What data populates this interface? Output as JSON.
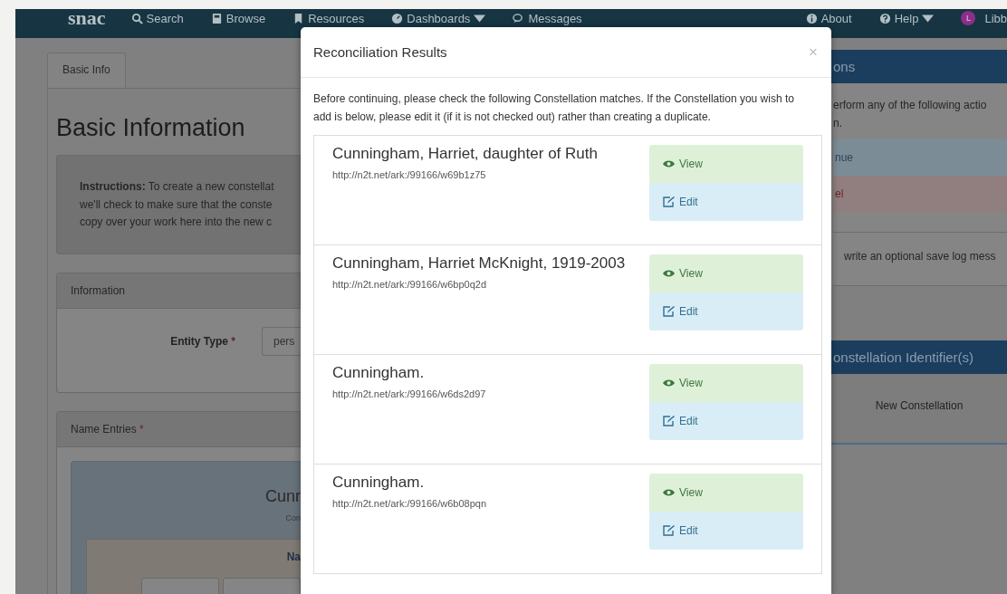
{
  "navbar": {
    "brand": "snac",
    "items": [
      {
        "label": "Search",
        "has_menu": false
      },
      {
        "label": "Browse",
        "has_menu": false
      },
      {
        "label": "Resources",
        "has_menu": false
      },
      {
        "label": "Dashboards",
        "has_menu": true
      },
      {
        "label": "Messages",
        "has_menu": false
      }
    ],
    "right_items": [
      {
        "label": "About",
        "has_menu": false
      },
      {
        "label": "Help",
        "has_menu": true
      }
    ],
    "avatar": "L",
    "user": "Libb"
  },
  "editor": {
    "tab": "Basic Info",
    "heading": "Basic Information",
    "instructions": [
      "**Instructions:** To create a new constellat",
      "we'll check to make sure that the conste",
      "copy over your work here into the new c"
    ],
    "information": {
      "title": "Information",
      "field_label": "Entity Type",
      "required_mark": "*",
      "field_value": "pers"
    },
    "name_entries": {
      "title": "Name Entries",
      "required_mark": "*",
      "heading": "Cunr",
      "subheading": "Con",
      "inner_heading": "Na"
    }
  },
  "modal": {
    "title": "Reconciliation Results",
    "close": "×",
    "intro": "Before continuing, please check the following Constellation matches. If the Constellation you wish to add is below, please edit it (if it is not checked out) rather than creating a duplicate.",
    "results": [
      {
        "name": "Cunningham, Harriet, daughter of Ruth",
        "url": "http://n2t.net/ark:/99166/w69b1z75",
        "view": "View",
        "edit": "Edit"
      },
      {
        "name": "Cunningham, Harriet McKnight, 1919-2003",
        "url": "http://n2t.net/ark:/99166/w6bp0q2d",
        "view": "View",
        "edit": "Edit"
      },
      {
        "name": "Cunningham.",
        "url": "http://n2t.net/ark:/99166/w6ds2d97",
        "view": "View",
        "edit": "Edit"
      },
      {
        "name": "Cunningham.",
        "url": "http://n2t.net/ark:/99166/w6b08pqn",
        "view": "View",
        "edit": "Edit"
      }
    ]
  },
  "actions_panel": {
    "title": "ons",
    "text": "erform any of the following actio",
    "text_2": "n.",
    "buttons": [
      {
        "label": "nue",
        "kind": "primary"
      },
      {
        "label": "el",
        "kind": "danger"
      }
    ],
    "log_text": "write an optional save log mess"
  },
  "identifiers_panel": {
    "title": "onstellation Identifier(s)",
    "value": "New Constellation"
  }
}
